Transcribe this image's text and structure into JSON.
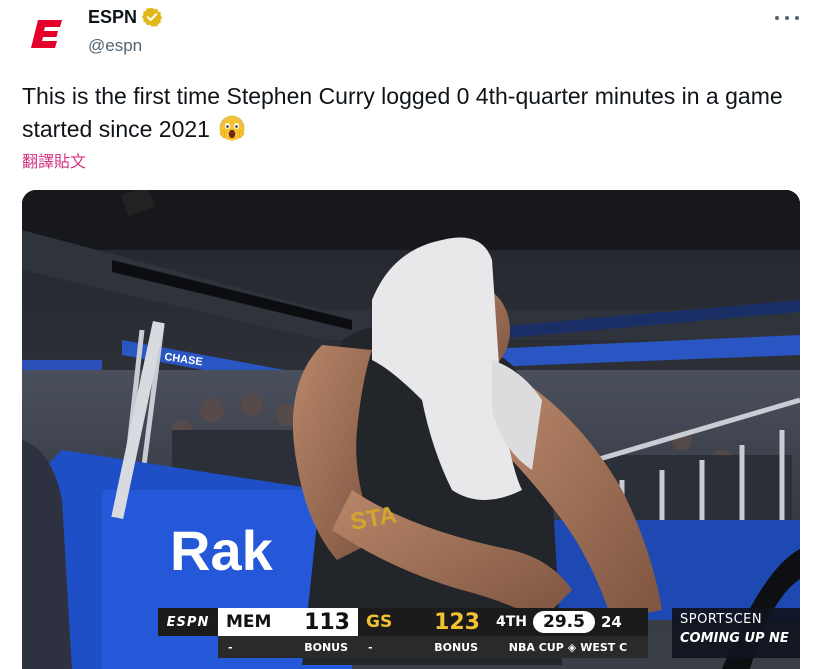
{
  "author": {
    "display_name": "ESPN",
    "handle": "@espn",
    "verified_color": "#e2b719"
  },
  "tweet": {
    "text": "This is the first time Stephen Curry logged 0 4th-quarter minutes in a game started since 2021",
    "emoji": "face-screaming-in-fear",
    "translate_label": "翻譯貼文"
  },
  "colors": {
    "brand_red": "#e4002b",
    "translate_link": "#d63384",
    "text_primary": "#0f1419",
    "text_secondary": "#536471"
  },
  "scoreboard": {
    "network": "ESPN",
    "away_team": "MEM",
    "away_score": "113",
    "home_team": "GS",
    "home_score": "123",
    "quarter": "4TH",
    "clock": "29.5",
    "shot_clock": "24",
    "away_sub_left": "-",
    "away_sub_right": "BONUS",
    "home_sub_left": "-",
    "home_sub_right": "BONUS",
    "event": "NBA CUP",
    "event_detail": "WEST C",
    "promo_line1": "SPORTSCEN",
    "promo_line2": "COMING UP NE"
  },
  "scene_text": {
    "court_sign": "Rak",
    "arena_banner": "CHASE"
  }
}
